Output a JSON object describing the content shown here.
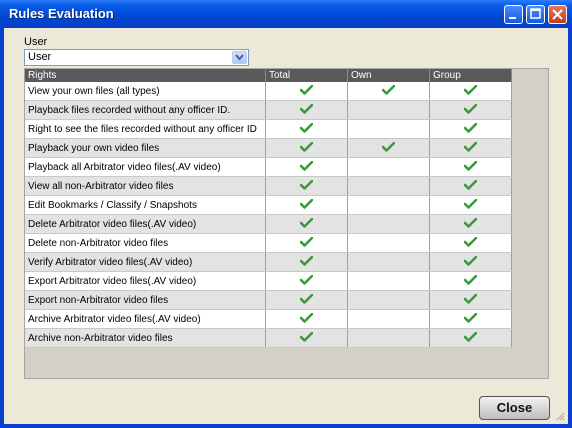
{
  "window": {
    "title": "Rules Evaluation"
  },
  "user_selector": {
    "label": "User",
    "value": "User"
  },
  "grid": {
    "columns": [
      "Rights",
      "Total",
      "Own",
      "Group"
    ],
    "rows": [
      {
        "right": "View your own files (all types)",
        "total": true,
        "own": true,
        "group": true
      },
      {
        "right": "Playback files recorded without any officer ID.",
        "total": true,
        "own": false,
        "group": true
      },
      {
        "right": "Right to see the files recorded without any officer ID",
        "total": true,
        "own": false,
        "group": true
      },
      {
        "right": "Playback your own video files",
        "total": true,
        "own": true,
        "group": true
      },
      {
        "right": "Playback all Arbitrator video files(.AV video)",
        "total": true,
        "own": false,
        "group": true
      },
      {
        "right": "View all non-Arbitrator video files",
        "total": true,
        "own": false,
        "group": true
      },
      {
        "right": "Edit Bookmarks / Classify / Snapshots",
        "total": true,
        "own": false,
        "group": true
      },
      {
        "right": "Delete Arbitrator video files(.AV video)",
        "total": true,
        "own": false,
        "group": true
      },
      {
        "right": "Delete non-Arbitrator video files",
        "total": true,
        "own": false,
        "group": true
      },
      {
        "right": "Verify Arbitrator video files(.AV video)",
        "total": true,
        "own": false,
        "group": true
      },
      {
        "right": "Export Arbitrator video files(.AV video)",
        "total": true,
        "own": false,
        "group": true
      },
      {
        "right": "Export non-Arbitrator video files",
        "total": true,
        "own": false,
        "group": true
      },
      {
        "right": "Archive Arbitrator video files(.AV video)",
        "total": true,
        "own": false,
        "group": true
      },
      {
        "right": "Archive non-Arbitrator video files",
        "total": true,
        "own": false,
        "group": true
      }
    ]
  },
  "buttons": {
    "close_label": "Close"
  },
  "colors": {
    "titlebar": "#0046d5",
    "check": "#3a9a3a",
    "header": "#5a5a5a"
  },
  "icons": {
    "check": "check-icon",
    "minimize": "minimize-icon",
    "maximize": "maximize-icon",
    "close": "close-icon",
    "dropdown": "chevron-down-icon"
  }
}
